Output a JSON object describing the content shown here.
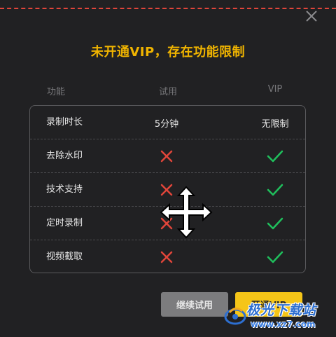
{
  "dialog": {
    "title": "未开通VIP，存在功能限制",
    "close_icon": "close-icon"
  },
  "table": {
    "headers": [
      "功能",
      "试用",
      "VIP"
    ],
    "rows": [
      {
        "feature": "录制时长",
        "trial": "5分钟",
        "vip": "无限制"
      },
      {
        "feature": "去除水印",
        "trial": "cross-icon",
        "vip": "check-icon"
      },
      {
        "feature": "技术支持",
        "trial": "cross-icon",
        "vip": "check-icon"
      },
      {
        "feature": "定时录制",
        "trial": "cross-icon",
        "vip": "check-icon"
      },
      {
        "feature": "视频截取",
        "trial": "cross-icon",
        "vip": "check-icon"
      }
    ]
  },
  "buttons": {
    "continue_trial": "继续试用",
    "open_vip": "开通VIP"
  },
  "watermark": {
    "name": "极光下载站",
    "url": "www.xz7.com"
  },
  "colors": {
    "accent": "#f0b400",
    "cross": "#e0453a",
    "check": "#1fbf5c",
    "background": "#212123"
  }
}
